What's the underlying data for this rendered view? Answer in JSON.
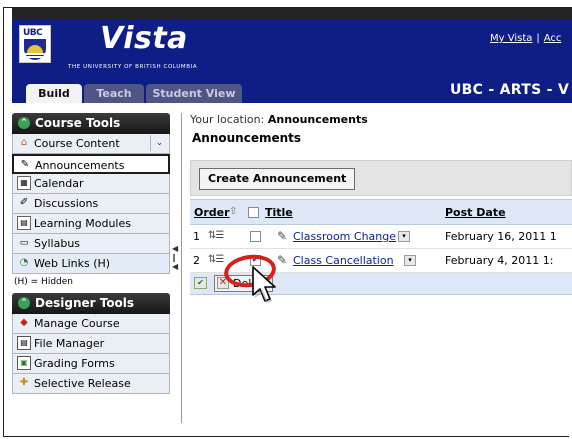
{
  "header": {
    "brand": "Vista",
    "crest_text": "UBC",
    "university": "THE UNIVERSITY OF BRITISH COLUMBIA",
    "links": [
      "My Vista",
      "Acc"
    ],
    "course_title": "UBC - ARTS - V",
    "tabs": [
      {
        "label": "Build",
        "active": true
      },
      {
        "label": "Teach",
        "active": false
      },
      {
        "label": "Student View",
        "active": false
      }
    ]
  },
  "sidebar": {
    "course_tools": {
      "heading": "Course Tools",
      "items": [
        {
          "label": "Course Content",
          "icon": "home-icon",
          "collapse_glyph": "⌄"
        },
        {
          "label": "Announcements",
          "icon": "megaphone-icon",
          "selected": true
        },
        {
          "label": "Calendar",
          "icon": "calendar-icon"
        },
        {
          "label": "Discussions",
          "icon": "discussion-icon"
        },
        {
          "label": "Learning Modules",
          "icon": "modules-icon"
        },
        {
          "label": "Syllabus",
          "icon": "syllabus-icon"
        },
        {
          "label": "Web Links (H)",
          "icon": "weblink-icon"
        }
      ],
      "hidden_note": "(H) = Hidden"
    },
    "designer_tools": {
      "heading": "Designer Tools",
      "items": [
        {
          "label": "Manage Course",
          "icon": "manage-icon"
        },
        {
          "label": "File Manager",
          "icon": "file-icon"
        },
        {
          "label": "Grading Forms",
          "icon": "grading-icon"
        },
        {
          "label": "Selective Release",
          "icon": "release-icon"
        }
      ]
    }
  },
  "main": {
    "location_prefix": "Your location:",
    "location": "Announcements",
    "heading": "Announcements",
    "create_button": "Create Announcement",
    "columns": {
      "order": "Order",
      "title": "Title",
      "post_date": "Post Date"
    },
    "rows": [
      {
        "order": "1",
        "title": "Classroom Change",
        "date": "February 16, 2011 1",
        "checked": false
      },
      {
        "order": "2",
        "title": "Class Cancellation",
        "date": "February 4, 2011 1:",
        "checked": true
      }
    ],
    "delete_button": "Delete"
  },
  "colors": {
    "header_bg": "#0f1e86",
    "link": "#0a1f9c",
    "highlight_ring": "#d5201d"
  }
}
